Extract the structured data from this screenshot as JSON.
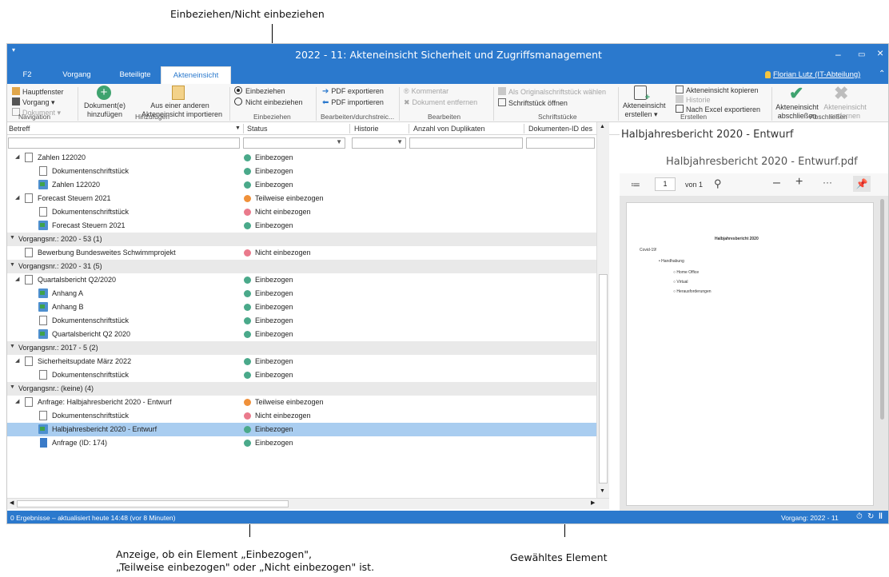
{
  "callouts": {
    "top": "Einbeziehen/Nicht einbeziehen",
    "bottom_left_line1": "Anzeige, ob ein Element „Einbezogen\",",
    "bottom_left_line2": "„Teilweise einbezogen\" oder „Nicht einbezogen\" ist.",
    "bottom_right": "Gewähltes Element"
  },
  "window": {
    "title": "2022 - 11: Akteneinsicht Sicherheit und Zugriffsmanagement",
    "minimize": "–",
    "maximize": "▭",
    "close": "×"
  },
  "tabs": [
    "F2",
    "Vorgang",
    "Beteiligte",
    "Akteneinsicht"
  ],
  "user": "Florian Lutz (IT-Abteilung)",
  "ribbon": {
    "navigation": {
      "hauptfenster": "Hauptfenster",
      "vorgang": "Vorgang ▾",
      "dokument": "Dokument ▾",
      "label": "Navigation"
    },
    "hinzufuegen": {
      "dokument_l1": "Dokument(e)",
      "dokument_l2": "hinzufügen",
      "import_l1": "Aus einer anderen",
      "import_l2": "Akteneinsicht importieren",
      "label": "Hinzufügen"
    },
    "einbeziehen": {
      "opt1": "Einbeziehen",
      "opt2": "Nicht einbeziehen",
      "label": "Einbeziehen"
    },
    "bearbeiten_durch": {
      "export": "PDF exportieren",
      "import": "PDF importieren",
      "label": "Bearbeiten/durchstreic..."
    },
    "bearbeiten": {
      "kommentar": "Kommentar",
      "entfernen": "Dokument entfernen",
      "label": "Bearbeiten"
    },
    "schriftstuecke": {
      "original": "Als Originalschriftstück wählen",
      "oeffnen": "Schriftstück öffnen",
      "label": "Schriftstücke"
    },
    "erstellen": {
      "ae_l1": "Akteneinsicht",
      "ae_l2": "erstellen ▾",
      "kopieren": "Akteneinsicht kopieren",
      "historie": "Historie",
      "excel": "Nach Excel exportieren",
      "label": "Erstellen"
    },
    "abschliessen": {
      "abs_l1": "Akteneinsicht",
      "abs_l2": "abschließen",
      "ent_l1": "Akteneinsicht",
      "ent_l2": "entfernen",
      "label": "Abschließen"
    }
  },
  "columns": [
    "Betreff",
    "Status",
    "Historie",
    "Anzahl von Duplikaten",
    "Dokumenten-ID des"
  ],
  "rows": [
    {
      "text": "Zahlen 122020",
      "status": "Einbezogen"
    },
    {
      "text": "Dokumentenschriftstück",
      "status": "Einbezogen"
    },
    {
      "text": "Zahlen 122020",
      "status": "Einbezogen"
    },
    {
      "text": "Forecast Steuern 2021",
      "status": "Teilweise einbezogen"
    },
    {
      "text": "Dokumentenschriftstück",
      "status": "Nicht einbezogen"
    },
    {
      "text": "Forecast Steuern 2021",
      "status": "Einbezogen"
    },
    {
      "text": "Vorgangsnr.: 2020 - 53 (1)",
      "status": ""
    },
    {
      "text": "Bewerbung Bundesweites Schwimmprojekt",
      "status": "Nicht einbezogen"
    },
    {
      "text": "Vorgangsnr.: 2020 - 31 (5)",
      "status": ""
    },
    {
      "text": "Quartalsbericht Q2/2020",
      "status": "Einbezogen"
    },
    {
      "text": "Anhang A",
      "status": "Einbezogen"
    },
    {
      "text": "Anhang B",
      "status": "Einbezogen"
    },
    {
      "text": "Dokumentenschriftstück",
      "status": "Einbezogen"
    },
    {
      "text": "Quartalsbericht Q2 2020",
      "status": "Einbezogen"
    },
    {
      "text": "Vorgangsnr.: 2017 - 5 (2)",
      "status": ""
    },
    {
      "text": "Sicherheitsupdate März 2022",
      "status": "Einbezogen"
    },
    {
      "text": "Dokumentenschriftstück",
      "status": "Einbezogen"
    },
    {
      "text": "Vorgangsnr.: (keine) (4)",
      "status": ""
    },
    {
      "text": "Anfrage: Halbjahresbericht 2020 - Entwurf",
      "status": "Teilweise einbezogen"
    },
    {
      "text": "Dokumentenschriftstück",
      "status": "Nicht einbezogen"
    },
    {
      "text": "Halbjahresbericht 2020 - Entwurf",
      "status": "Einbezogen"
    },
    {
      "text": "Anfrage (ID: 174)",
      "status": "Einbezogen"
    }
  ],
  "status_colors": {
    "Einbezogen": "#4aa98a",
    "Teilweise einbezogen": "#f0913a",
    "Nicht einbezogen": "#ea7a8c"
  },
  "preview": {
    "title": "Halbjahresbericht 2020 - Entwurf",
    "filename": "Halbjahresbericht 2020 - Entwurf.pdf",
    "page": "1",
    "of": "von 1",
    "doc_heading": "Halbjahresbericht 2020",
    "doc_line1": "Covid-19!",
    "doc_bullet": "Handhabung",
    "doc_sub1": "Home Office",
    "doc_sub2": "Virtual",
    "doc_sub3": "Herausforderungen"
  },
  "statusbar": {
    "left": "0 Ergebnisse – aktualisiert heute 14:48 (vor 8 Minuten)",
    "right": "Vorgang: 2022 - 11"
  }
}
